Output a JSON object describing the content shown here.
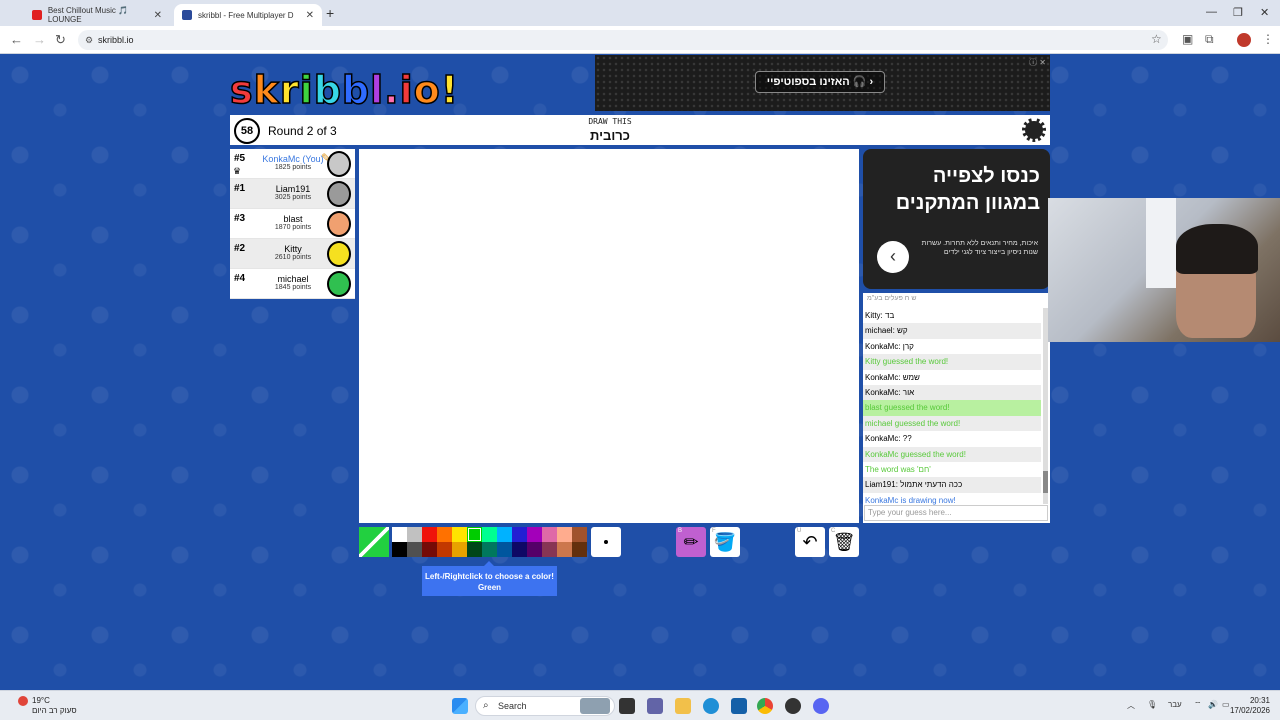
{
  "browser": {
    "tabs": [
      {
        "title": "Best Chillout Music 🎵 LOUNGE",
        "active": false
      },
      {
        "title": "skribbl - Free Multiplayer D",
        "active": true
      }
    ],
    "url": "skribbl.io"
  },
  "ad_top": {
    "button": "האזינו בספוטיפיי 🎧 ›"
  },
  "game": {
    "logo": [
      "s",
      "k",
      "r",
      "i",
      "b",
      "b",
      "l",
      ".",
      "i",
      "o",
      "!"
    ],
    "timer": "58",
    "round": "Round 2 of 3",
    "draw_this": "DRAW THIS",
    "word": "כרובית"
  },
  "players": [
    {
      "rank": "#5",
      "name": "KonkaMc (You)",
      "points": "1825 points",
      "me": true,
      "color": "#c8c8c8"
    },
    {
      "rank": "#1",
      "name": "Liam191",
      "points": "3025 points",
      "me": false,
      "color": "#9a9a9a"
    },
    {
      "rank": "#3",
      "name": "blast",
      "points": "1870 points",
      "me": false,
      "color": "#f0a070"
    },
    {
      "rank": "#2",
      "name": "Kitty",
      "points": "2610 points",
      "me": false,
      "color": "#f5e020"
    },
    {
      "rank": "#4",
      "name": "michael",
      "points": "1845 points",
      "me": false,
      "color": "#30c050"
    }
  ],
  "ad_right": {
    "headline_1": "כנסו לצפייה",
    "headline_2": "במגוון המתקנים",
    "body": "איכות, מחיר ותנאים ללא תחרות. עשרות שנות ניסיון בייצור ציוד לגני ילדים"
  },
  "chat": {
    "ad_info": "ש ח פעלים בע\"מ",
    "messages": [
      {
        "text": "Kitty: בד",
        "type": "normal"
      },
      {
        "text": "michael: קש",
        "type": "normal"
      },
      {
        "text": "KonkaMc: קרן",
        "type": "normal"
      },
      {
        "text": "Kitty guessed the word!",
        "type": "ok"
      },
      {
        "text": "KonkaMc: שמש",
        "type": "normal"
      },
      {
        "text": "KonkaMc: אור",
        "type": "normal"
      },
      {
        "text": "blast guessed the word!",
        "type": "okhl"
      },
      {
        "text": "michael guessed the word!",
        "type": "ok"
      },
      {
        "text": "KonkaMc: ??",
        "type": "normal"
      },
      {
        "text": "KonkaMc guessed the word!",
        "type": "ok"
      },
      {
        "text": "The word was 'חם'",
        "type": "ok"
      },
      {
        "text": "Liam191: ככה הדעתי אתמול",
        "type": "normal"
      },
      {
        "text": "KonkaMc is drawing now!",
        "type": "sys"
      }
    ],
    "placeholder": "Type your guess here..."
  },
  "palette": {
    "row1": [
      "#ffffff",
      "#c1c1c1",
      "#ef130b",
      "#ff7100",
      "#ffe400",
      "#00cc00",
      "#00ff91",
      "#00b2ff",
      "#231fd3",
      "#a300ba",
      "#df69a7",
      "#ffac8e",
      "#a0522d"
    ],
    "row2": [
      "#000000",
      "#505050",
      "#740b07",
      "#c23800",
      "#e8a200",
      "#004619",
      "#00785d",
      "#00569e",
      "#0e0865",
      "#550069",
      "#873554",
      "#cc774d",
      "#63300d"
    ],
    "selected_index": 5
  },
  "tooltip": {
    "line1": "Left-/Rightclick to choose a color!",
    "line2": "Green"
  },
  "tools": {
    "brush_key": "B",
    "fill_key": "F",
    "undo_key": "U",
    "clear_key": "C"
  },
  "taskbar": {
    "temperature": "19°C",
    "weather_text": "סעוק רב היום",
    "search": "Search",
    "lang": "עבר",
    "time": "20:31",
    "date": "17/02/2026"
  }
}
